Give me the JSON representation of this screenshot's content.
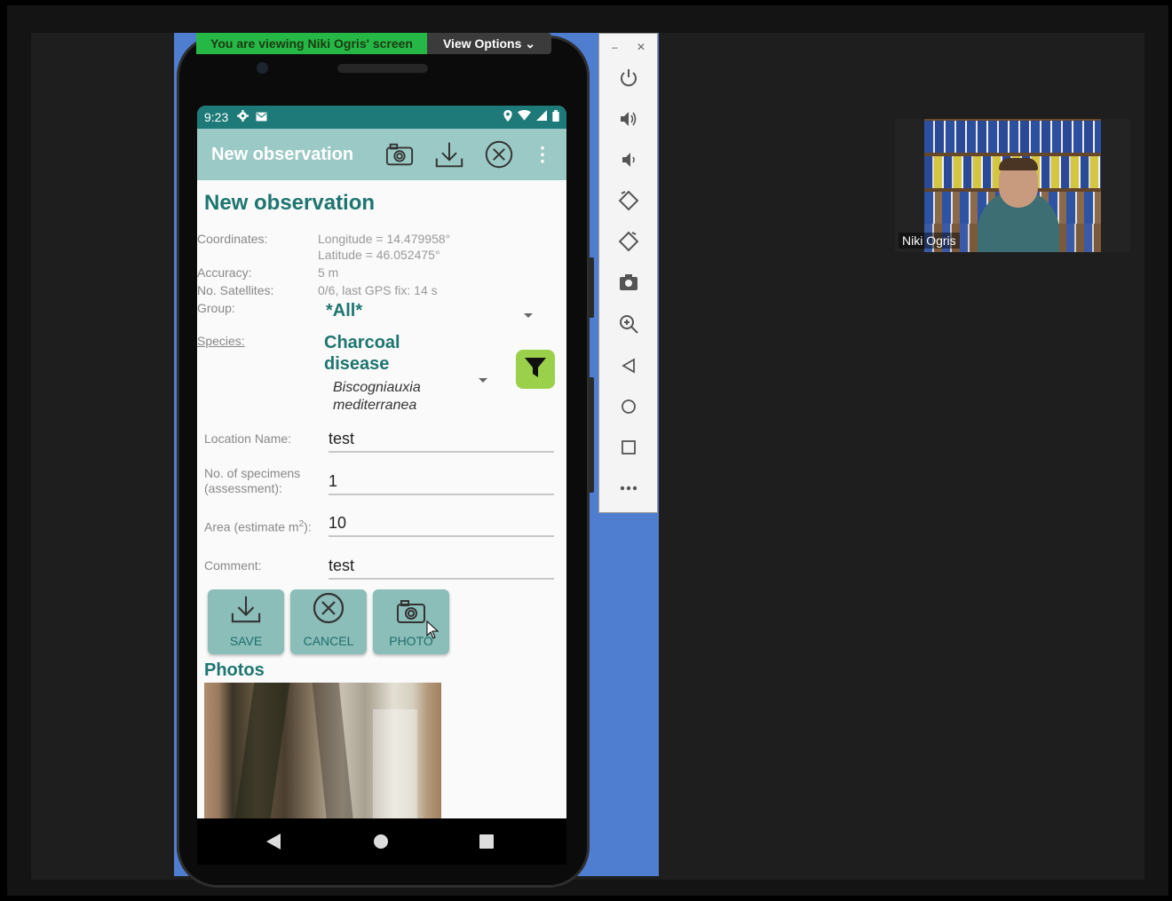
{
  "meeting": {
    "banner_text": "You are viewing Niki Ogris' screen",
    "view_options_label": "View Options ⌄",
    "participant_name": "Niki Ogris"
  },
  "phone": {
    "status": {
      "time": "9:23",
      "icons_left": [
        "settings-icon",
        "mail-icon"
      ],
      "icons_right": [
        "location-icon",
        "wifi-icon",
        "signal-icon",
        "battery-icon"
      ]
    },
    "appbar": {
      "title": "New observation",
      "actions": [
        "camera-icon",
        "download-icon",
        "close-circle-icon",
        "overflow-menu-icon"
      ]
    },
    "form": {
      "heading": "New observation",
      "coordinates_label": "Coordinates:",
      "longitude": "Longitude = 14.479958°",
      "latitude": "Latitude = 46.052475°",
      "accuracy_label": "Accuracy:",
      "accuracy_value": "5 m",
      "satellites_label": "No. Satellites:",
      "satellites_value": "0/6, last GPS fix: 14 s",
      "group_label": "Group:",
      "group_value": "*All*",
      "species_label": "Species:",
      "species_common_line1": "Charcoal",
      "species_common_line2": "disease",
      "species_latin_line1": "Biscogniauxia",
      "species_latin_line2": "mediterranea",
      "location_label": "Location Name:",
      "location_value": "test",
      "specimens_label_line1": "No. of specimens",
      "specimens_label_line2": "(assessment):",
      "specimens_value": "1",
      "area_label_prefix": "Area (estimate m",
      "area_label_sup": "2",
      "area_label_suffix": "):",
      "area_value": "10",
      "comment_label": "Comment:",
      "comment_value": "test"
    },
    "buttons": {
      "save": "SAVE",
      "cancel": "CANCEL",
      "photo": "PHOTO"
    },
    "photos_heading": "Photos"
  },
  "colors": {
    "status_bar": "#1d7a78",
    "app_bar": "#9bc9c5",
    "accent_teal": "#1e7570",
    "filter_button": "#9ad04a",
    "zoom_banner": "#25b846"
  },
  "emulator_toolbar": [
    "minimize-icon",
    "close-icon",
    "power-icon",
    "volume-up-icon",
    "volume-down-icon",
    "rotate-left-icon",
    "rotate-right-icon",
    "screenshot-icon",
    "zoom-icon",
    "back-icon",
    "home-icon",
    "overview-icon",
    "more-icon"
  ]
}
